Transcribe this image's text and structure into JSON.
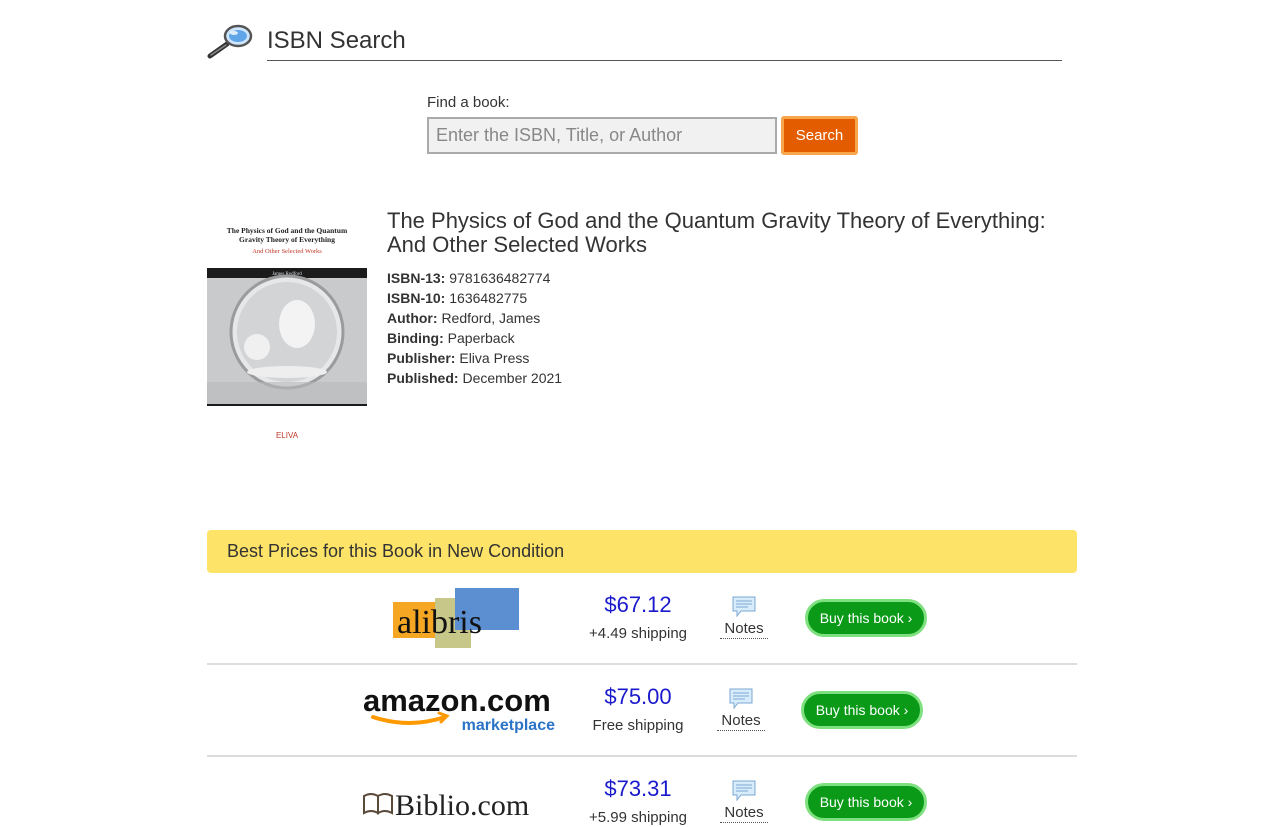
{
  "header": {
    "title": "ISBN Search",
    "icon": "magnifying-glass-icon"
  },
  "search": {
    "label": "Find a book:",
    "placeholder": "Enter the ISBN, Title, or Author",
    "value": "",
    "button_label": "Search"
  },
  "book": {
    "title": "The Physics of God and the Quantum Gravity Theory of Everything: And Other Selected Works",
    "cover": {
      "title_line1": "The Physics of God and the Quantum",
      "title_line2": "Gravity Theory of Everything",
      "subtitle": "And Other Selected Works",
      "author": "James Redford",
      "publisher_mark": "ELIVA"
    },
    "fields": [
      {
        "label": "ISBN-13:",
        "value": "9781636482774"
      },
      {
        "label": "ISBN-10:",
        "value": "1636482775"
      },
      {
        "label": "Author:",
        "value": "Redford, James"
      },
      {
        "label": "Binding:",
        "value": "Paperback"
      },
      {
        "label": "Publisher:",
        "value": "Eliva Press"
      },
      {
        "label": "Published:",
        "value": "December 2021"
      }
    ]
  },
  "prices": {
    "header": "Best Prices for this Book in New Condition",
    "offers": [
      {
        "seller": "alibris",
        "logo_text": "alibris",
        "price": "$67.12",
        "shipping": "+4.49 shipping",
        "notes_label": "Notes",
        "buy_label": "Buy this book ›"
      },
      {
        "seller": "amazon-marketplace",
        "logo_text": "amazon.com",
        "logo_subtext": "marketplace",
        "price": "$75.00",
        "shipping": "Free shipping",
        "notes_label": "Notes",
        "buy_label": "Buy this book ›"
      },
      {
        "seller": "biblio",
        "logo_text": "Biblio.com",
        "price": "$73.31",
        "shipping": "+5.99 shipping",
        "notes_label": "Notes",
        "buy_label": "Buy this book ›"
      }
    ]
  },
  "colors": {
    "search_button": "#e35d00",
    "buy_button": "#0a9a18",
    "price_text": "#1a1acc",
    "prices_header_bg": "#fde367"
  }
}
